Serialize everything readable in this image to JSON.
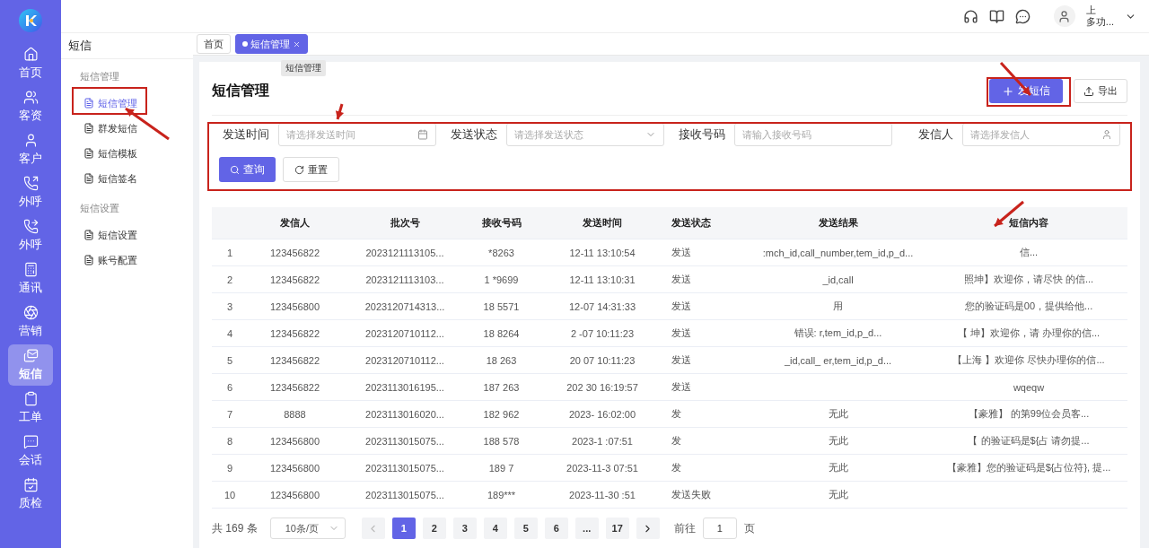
{
  "rail": {
    "items": [
      {
        "kind": "home",
        "label": "首页",
        "selected": false
      },
      {
        "kind": "users",
        "label": "客资",
        "selected": false
      },
      {
        "kind": "user",
        "label": "客户",
        "selected": false
      },
      {
        "kind": "phone-out",
        "label": "外呼",
        "selected": false
      },
      {
        "kind": "phone-forward",
        "label": "外呼",
        "selected": false
      },
      {
        "kind": "contacts",
        "label": "通讯",
        "selected": false
      },
      {
        "kind": "aperture",
        "label": "营销",
        "selected": false
      },
      {
        "kind": "mail",
        "label": "短信",
        "selected": true
      },
      {
        "kind": "clipboard",
        "label": "工单",
        "selected": false
      },
      {
        "kind": "chat",
        "label": "会话",
        "selected": false
      },
      {
        "kind": "calendar",
        "label": "质检",
        "selected": false
      }
    ]
  },
  "header": {
    "user": {
      "line_1": "上",
      "line_2": "多功..."
    }
  },
  "submenu": {
    "title": "短信",
    "groups": [
      {
        "label": "短信管理",
        "items": [
          {
            "label": "短信管理",
            "selected": true
          },
          {
            "label": "群发短信",
            "selected": false
          },
          {
            "label": "短信模板",
            "selected": false
          },
          {
            "label": "短信签名",
            "selected": false
          }
        ]
      },
      {
        "label": "短信设置",
        "items": [
          {
            "label": "短信设置",
            "selected": false
          },
          {
            "label": "账号配置",
            "selected": false
          }
        ]
      }
    ]
  },
  "tabs": [
    {
      "label": "首页",
      "selected": false,
      "closable": false
    },
    {
      "label": "短信管理",
      "selected": true,
      "closable": true
    }
  ],
  "tooltip": "短信管理",
  "page": {
    "title": "短信管理",
    "primary_button": "发短信",
    "export_button": "导出"
  },
  "filters": [
    {
      "label": "发送时间",
      "placeholder": "请选择发送时间",
      "kind": "date"
    },
    {
      "label": "发送状态",
      "placeholder": "请选择发送状态",
      "kind": "select"
    },
    {
      "label": "接收号码",
      "placeholder": "请输入接收号码",
      "kind": "text"
    },
    {
      "label": "发信人",
      "placeholder": "请选择发信人",
      "kind": "person"
    }
  ],
  "filter_buttons": {
    "search": "查询",
    "reset": "重置"
  },
  "table": {
    "columns": [
      "",
      "发信人",
      "批次号",
      "接收号码",
      "发送时间",
      "发送状态",
      "发送结果",
      "短信内容"
    ],
    "rows": [
      [
        "1",
        "123456822",
        "2023121113105...",
        "*8263",
        "12-11 13:10:54",
        "发送",
        ":mch_id,call_number,tem_id,p_d...",
        "信..."
      ],
      [
        "2",
        "123456822",
        "2023121113103...",
        "1 *9699",
        "12-11 13:10:31",
        "发送",
        "_id,call",
        "照坤】欢迎你，请尽快 的信..."
      ],
      [
        "3",
        "123456800",
        "2023120714313...",
        "18 5571",
        "12-07 14:31:33",
        "发送",
        "用",
        "您的验证码是00，提供给他..."
      ],
      [
        "4",
        "123456822",
        "2023120710112...",
        "18 8264",
        "2 -07 10:11:23",
        "发送",
        "错误: r,tem_id,p_d...",
        "【 坤】欢迎你，请 办理你的信..."
      ],
      [
        "5",
        "123456822",
        "2023120710112...",
        "18 263",
        "20 07 10:11:23",
        "发送",
        "_id,call_ er,tem_id,p_d...",
        "【上海 】欢迎你 尽快办理你的信..."
      ],
      [
        "6",
        "123456822",
        "2023113016195...",
        "187 263",
        "202 30 16:19:57",
        "发送",
        null,
        "wqeqw"
      ],
      [
        "7",
        "8888",
        "2023113016020...",
        "182 962",
        "2023- 16:02:00",
        "发",
        "无此",
        "【豪雅】 的第99位会员客..."
      ],
      [
        "8",
        "123456800",
        "2023113015075...",
        "188 578",
        "2023-1 :07:51",
        "发",
        "无此",
        "【 的验证码是${占 请勿提..."
      ],
      [
        "9",
        "123456800",
        "2023113015075...",
        "189 7",
        "2023-11-3 07:51",
        "发",
        "无此",
        "【豪雅】您的验证码是${占位符}, 提..."
      ],
      [
        "10",
        "123456800",
        "2023113015075...",
        "189***",
        "2023-11-30 :51",
        "发送失败",
        "无此",
        null
      ]
    ]
  },
  "pagination": {
    "total": "共 169 条",
    "page_size": "10条/页",
    "pages": [
      {
        "label": "1",
        "selected": true
      },
      {
        "label": "2",
        "selected": false
      },
      {
        "label": "3",
        "selected": false
      },
      {
        "label": "4",
        "selected": false
      },
      {
        "label": "5",
        "selected": false
      },
      {
        "label": "6",
        "selected": false
      },
      {
        "label": "...",
        "selected": false
      },
      {
        "label": "17",
        "selected": false
      }
    ],
    "goto_label": "前往",
    "goto_value": "1",
    "goto_suffix": "页"
  }
}
